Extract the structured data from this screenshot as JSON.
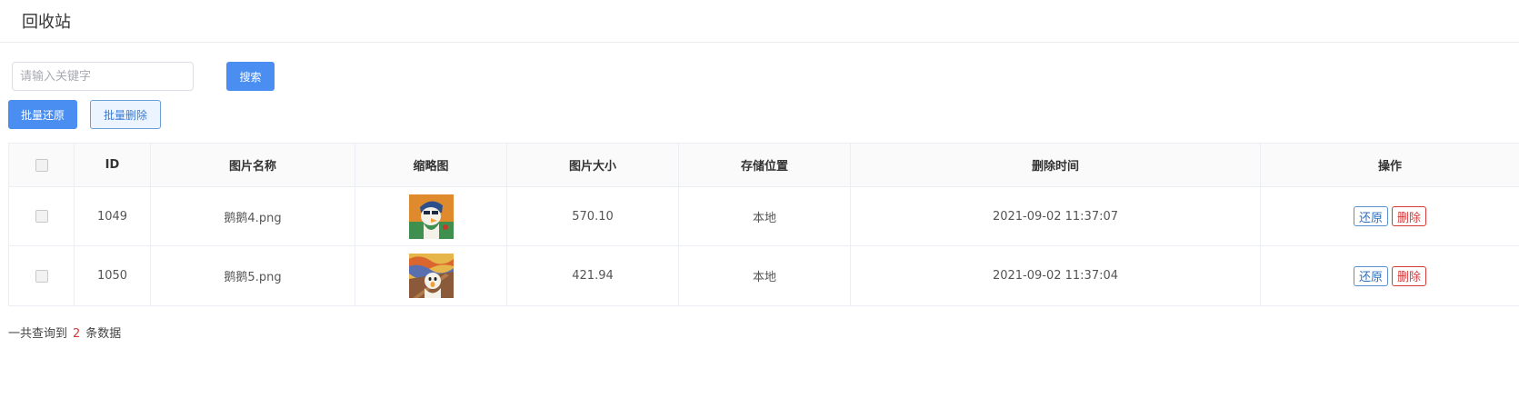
{
  "header": {
    "title": "回收站"
  },
  "toolbar": {
    "search_placeholder": "请输入关键字",
    "search_label": "搜索",
    "restore_all_label": "批量还原",
    "delete_all_label": "批量删除"
  },
  "table": {
    "columns": {
      "id": "ID",
      "name": "图片名称",
      "thumb": "缩略图",
      "size": "图片大小",
      "location": "存储位置",
      "deleted_at": "删除时间",
      "ops": "操作"
    },
    "rows": [
      {
        "id": "1049",
        "name": "鹅鹅4.png",
        "size": "570.10",
        "location": "本地",
        "deleted_at": "2021-09-02 11:37:07",
        "restore_label": "还原",
        "delete_label": "删除"
      },
      {
        "id": "1050",
        "name": "鹅鹅5.png",
        "size": "421.94",
        "location": "本地",
        "deleted_at": "2021-09-02 11:37:04",
        "restore_label": "还原",
        "delete_label": "删除"
      }
    ]
  },
  "footer": {
    "prefix": "一共查询到",
    "count": "2",
    "suffix": "条数据"
  },
  "colors": {
    "primary": "#4a8ef2",
    "danger": "#d23c3c",
    "border": "#ebeef5"
  }
}
